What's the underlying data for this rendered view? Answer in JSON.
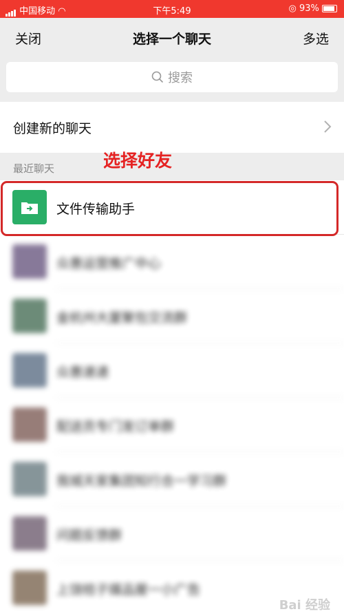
{
  "status": {
    "carrier": "中国移动",
    "time": "下午5:49",
    "battery": "93%"
  },
  "nav": {
    "close": "关闭",
    "title": "选择一个聊天",
    "multi": "多选"
  },
  "search": {
    "placeholder": "搜索"
  },
  "new_chat": {
    "label": "创建新的聊天"
  },
  "section": {
    "recent": "最近聊天"
  },
  "annotation": "选择好友",
  "chats": [
    {
      "name": "文件传输助手",
      "avatar_color": "#2aae67"
    },
    {
      "name": "众惠运营推广中心",
      "avatar_color": "#7b6b8f"
    },
    {
      "name": "金杭州大厦聚包交流群",
      "avatar_color": "#5d7f6a"
    },
    {
      "name": "众惠速递",
      "avatar_color": "#6e7f93"
    },
    {
      "name": "配送员专门发订单群",
      "avatar_color": "#8c6f6a"
    },
    {
      "name": "我城天家集团知行合一学习群",
      "avatar_color": "#7a8a8f"
    },
    {
      "name": "问题反馈群",
      "avatar_color": "#7f7080"
    },
    {
      "name": "上饶桔子媒品屋一小广告",
      "avatar_color": "#8a7764"
    }
  ],
  "watermark": "Bai 经验"
}
